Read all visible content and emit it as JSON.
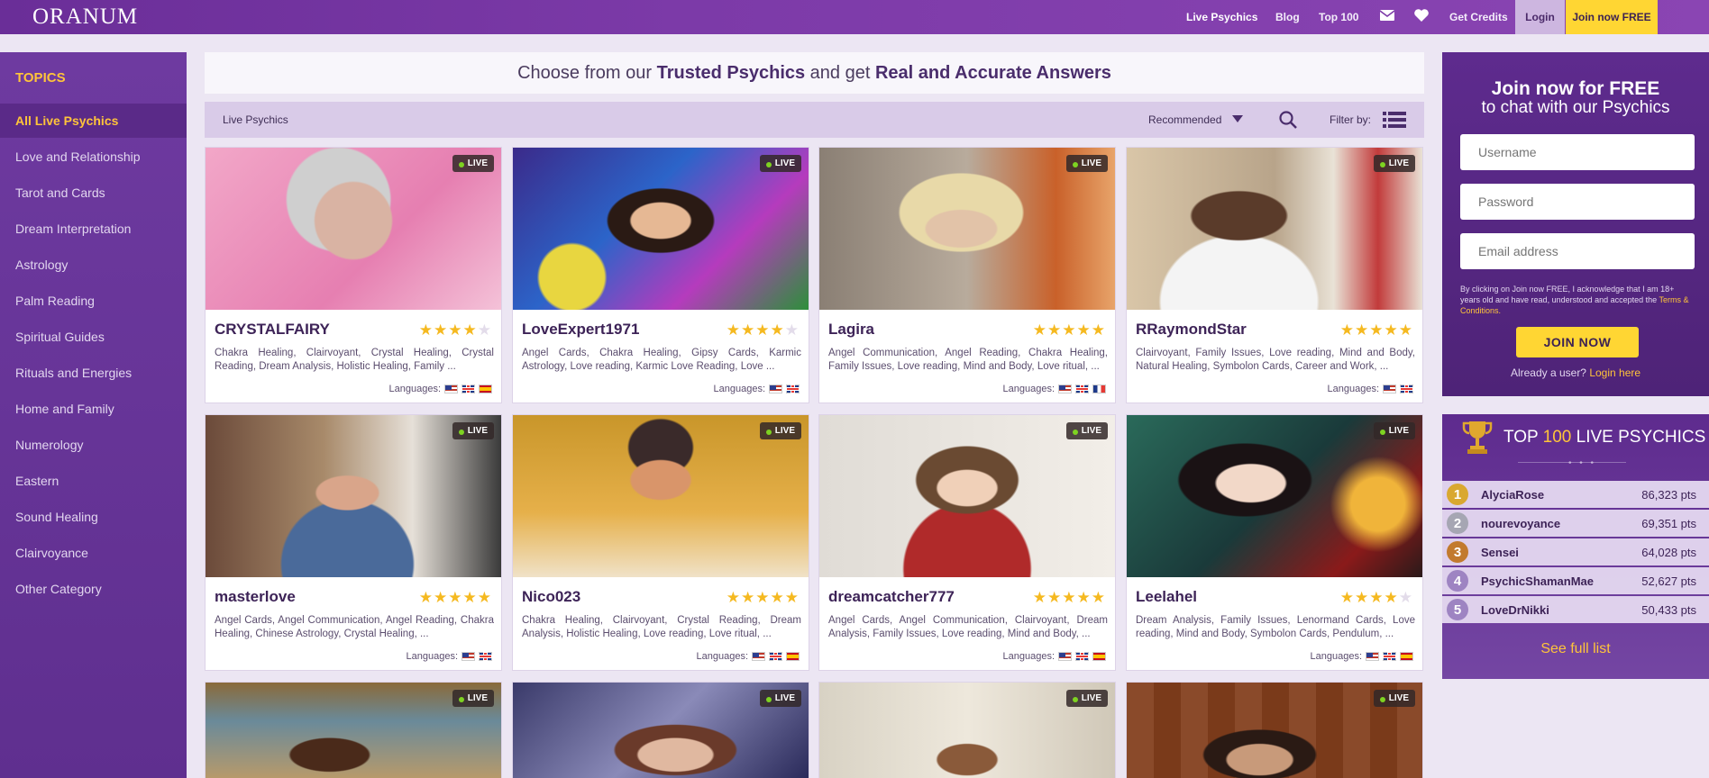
{
  "header": {
    "logo": "ORANUM",
    "nav": {
      "live_psychics": "Live Psychics",
      "blog": "Blog",
      "top100": "Top 100",
      "get_credits": "Get Credits",
      "login": "Login",
      "join": "Join now FREE"
    }
  },
  "sidebar": {
    "title": "TOPICS",
    "items": [
      {
        "label": "All Live Psychics"
      },
      {
        "label": "Love and Relationship"
      },
      {
        "label": "Tarot and Cards"
      },
      {
        "label": "Dream Interpretation"
      },
      {
        "label": "Astrology"
      },
      {
        "label": "Palm Reading"
      },
      {
        "label": "Spiritual Guides"
      },
      {
        "label": "Rituals and Energies"
      },
      {
        "label": "Home and Family"
      },
      {
        "label": "Numerology"
      },
      {
        "label": "Eastern"
      },
      {
        "label": "Sound Healing"
      },
      {
        "label": "Clairvoyance"
      },
      {
        "label": "Other Category"
      }
    ]
  },
  "banner": {
    "part1": "Choose from our ",
    "bold1": "Trusted Psychics",
    "part2": " and get ",
    "bold2": "Real and Accurate Answers"
  },
  "filterbar": {
    "crumb": "Live Psychics",
    "sort": "Recommended",
    "filter_label": "Filter by:"
  },
  "live_badge": "LIVE",
  "languages_label": "Languages:",
  "cards": [
    {
      "name": "CRYSTALFAIRY",
      "rating": 4,
      "desc": "Chakra Healing, Clairvoyant, Crystal Healing, Crystal Reading, Dream Analysis, Holistic Healing, Family ...",
      "langs": [
        "us",
        "gb",
        "es"
      ]
    },
    {
      "name": "LoveExpert1971",
      "rating": 4,
      "desc": "Angel Cards, Chakra Healing, Gipsy Cards, Karmic Astrology, Love reading, Karmic Love Reading, Love ...",
      "langs": [
        "us",
        "gb"
      ]
    },
    {
      "name": "Lagira",
      "rating": 5,
      "desc": "Angel Communication, Angel Reading, Chakra Healing, Family Issues, Love reading, Mind and Body, Love ritual, ...",
      "langs": [
        "us",
        "gb",
        "fr"
      ]
    },
    {
      "name": "RRaymondStar",
      "rating": 5,
      "desc": "Clairvoyant, Family Issues, Love reading, Mind and Body, Natural Healing, Symbolon Cards, Career and Work, ...",
      "langs": [
        "us",
        "gb"
      ]
    },
    {
      "name": "masterlove",
      "rating": 5,
      "desc": "Angel Cards, Angel Communication, Angel Reading, Chakra Healing, Chinese Astrology, Crystal Healing, ...",
      "langs": [
        "us",
        "gb"
      ]
    },
    {
      "name": "Nico023",
      "rating": 5,
      "desc": "Chakra Healing, Clairvoyant, Crystal Reading, Dream Analysis, Holistic Healing, Love reading, Love ritual, ...",
      "langs": [
        "us",
        "gb",
        "es"
      ]
    },
    {
      "name": "dreamcatcher777",
      "rating": 5,
      "desc": "Angel Cards, Angel Communication, Clairvoyant, Dream Analysis, Family Issues, Love reading, Mind and Body, ...",
      "langs": [
        "us",
        "gb",
        "es"
      ]
    },
    {
      "name": "Leelahel",
      "rating": 4,
      "desc": "Dream Analysis, Family Issues, Lenormand Cards, Love reading, Mind and Body, Symbolon Cards, Pendulum, ...",
      "langs": [
        "us",
        "gb",
        "es"
      ]
    }
  ],
  "join_panel": {
    "title": "Join now for FREE",
    "subtitle": "to chat with our Psychics",
    "username_placeholder": "Username",
    "password_placeholder": "Password",
    "email_placeholder": "Email address",
    "terms_text": "By clicking on Join now FREE, I acknowledge that I am 18+ years old and have read, understood and accepted the",
    "terms_link": "Terms & Conditions.",
    "button": "JOIN NOW",
    "already": "Already a user?",
    "login_link": "Login here"
  },
  "top_panel": {
    "title_pre": "TOP ",
    "title_num": "100",
    "title_post": " LIVE PSYCHICS",
    "entries": [
      {
        "rank": "1",
        "name": "AlyciaRose",
        "points": "86,323 pts",
        "color": "#d9a830"
      },
      {
        "rank": "2",
        "name": "nourevoyance",
        "points": "69,351 pts",
        "color": "#a6a6b3"
      },
      {
        "rank": "3",
        "name": "Sensei",
        "points": "64,028 pts",
        "color": "#c27a2e"
      },
      {
        "rank": "4",
        "name": "PsychicShamanMae",
        "points": "52,627 pts",
        "color": "#9e84c2"
      },
      {
        "rank": "5",
        "name": "LoveDrNikki",
        "points": "50,433 pts",
        "color": "#9e84c2"
      }
    ],
    "see_full": "See full list"
  }
}
